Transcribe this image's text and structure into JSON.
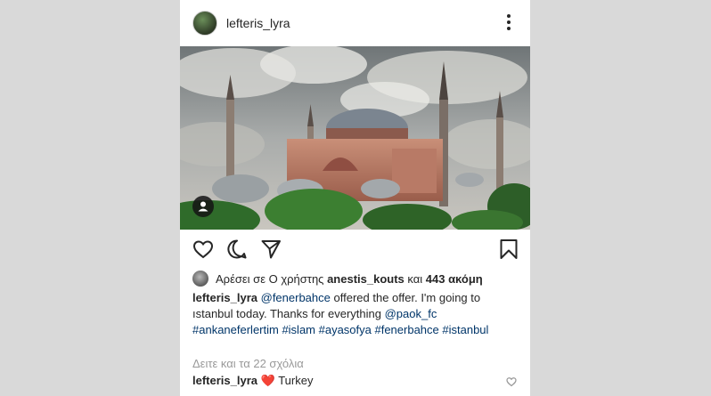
{
  "post": {
    "username": "lefteris_lyra",
    "likes": {
      "prefix": "Αρέσει σε Ο χρήστης",
      "user": "anestis_kouts",
      "middle": "και",
      "count": "443 ακόμη"
    },
    "caption": {
      "username": "lefteris_lyra",
      "mention1": "@fenerbahce",
      "text1": "offered the offer. I'm going to ıstanbul today. Thanks for everything",
      "mention2": "@paok_fc",
      "hashtags": "#ankaneferlertim #islam #ayasofya #fenerbahce #istanbul"
    },
    "view_comments": "Δειτε και τα 22 σχόλια",
    "comment": {
      "username": "lefteris_lyra",
      "emoji": "❤️",
      "text": "Turkey"
    }
  },
  "icons": {
    "like": "heart-icon",
    "comment": "comment-icon",
    "share": "paper-plane-icon",
    "save": "bookmark-icon",
    "more": "more-dots-icon",
    "tag": "user-tag-icon"
  }
}
